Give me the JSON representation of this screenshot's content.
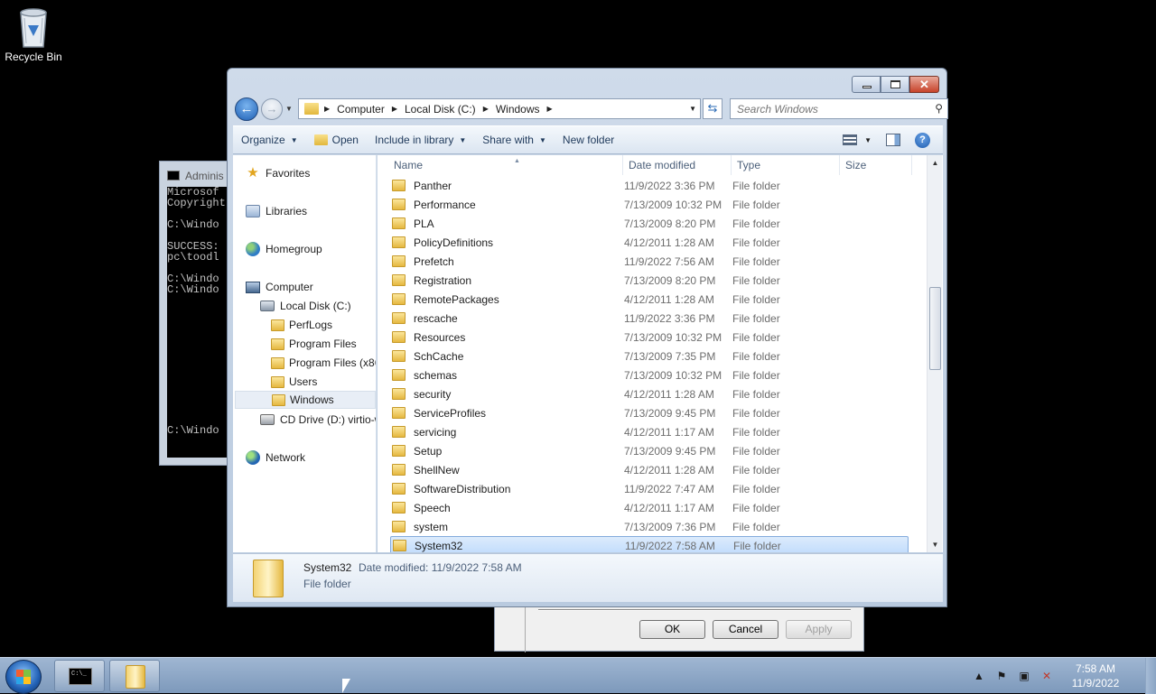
{
  "desktop": {
    "recycle_bin_label": "Recycle Bin"
  },
  "console": {
    "title": "Adminis",
    "lines": [
      "Microsof",
      "Copyright",
      "",
      "C:\\Windo",
      "",
      "SUCCESS:",
      "pc\\toodl",
      "",
      "C:\\Windo",
      "C:\\Windo",
      "",
      "",
      "",
      "",
      "",
      "",
      "",
      "",
      "",
      "",
      "",
      "",
      "C:\\Windo"
    ]
  },
  "properties_dialog": {
    "ok_label": "OK",
    "cancel_label": "Cancel",
    "apply_label": "Apply"
  },
  "explorer": {
    "breadcrumb": [
      "Computer",
      "Local Disk (C:)",
      "Windows"
    ],
    "search_placeholder": "Search Windows",
    "toolbar": {
      "organize": "Organize",
      "open": "Open",
      "include_in_library": "Include in library",
      "share_with": "Share with",
      "new_folder": "New folder"
    },
    "nav": {
      "favorites": "Favorites",
      "libraries": "Libraries",
      "homegroup": "Homegroup",
      "computer": "Computer",
      "local_disk": "Local Disk (C:)",
      "perflogs": "PerfLogs",
      "program_files": "Program Files",
      "program_files_x86": "Program Files (x86",
      "users": "Users",
      "windows": "Windows",
      "cd_drive": "CD Drive (D:) virtio-w",
      "network": "Network"
    },
    "columns": {
      "name": "Name",
      "date_modified": "Date modified",
      "type": "Type",
      "size": "Size"
    },
    "files": [
      {
        "name": "Panther",
        "date": "11/9/2022 3:36 PM",
        "type": "File folder"
      },
      {
        "name": "Performance",
        "date": "7/13/2009 10:32 PM",
        "type": "File folder"
      },
      {
        "name": "PLA",
        "date": "7/13/2009 8:20 PM",
        "type": "File folder"
      },
      {
        "name": "PolicyDefinitions",
        "date": "4/12/2011 1:28 AM",
        "type": "File folder"
      },
      {
        "name": "Prefetch",
        "date": "11/9/2022 7:56 AM",
        "type": "File folder"
      },
      {
        "name": "Registration",
        "date": "7/13/2009 8:20 PM",
        "type": "File folder"
      },
      {
        "name": "RemotePackages",
        "date": "4/12/2011 1:28 AM",
        "type": "File folder"
      },
      {
        "name": "rescache",
        "date": "11/9/2022 3:36 PM",
        "type": "File folder"
      },
      {
        "name": "Resources",
        "date": "7/13/2009 10:32 PM",
        "type": "File folder"
      },
      {
        "name": "SchCache",
        "date": "7/13/2009 7:35 PM",
        "type": "File folder"
      },
      {
        "name": "schemas",
        "date": "7/13/2009 10:32 PM",
        "type": "File folder"
      },
      {
        "name": "security",
        "date": "4/12/2011 1:28 AM",
        "type": "File folder"
      },
      {
        "name": "ServiceProfiles",
        "date": "7/13/2009 9:45 PM",
        "type": "File folder"
      },
      {
        "name": "servicing",
        "date": "4/12/2011 1:17 AM",
        "type": "File folder"
      },
      {
        "name": "Setup",
        "date": "7/13/2009 9:45 PM",
        "type": "File folder"
      },
      {
        "name": "ShellNew",
        "date": "4/12/2011 1:28 AM",
        "type": "File folder"
      },
      {
        "name": "SoftwareDistribution",
        "date": "11/9/2022 7:47 AM",
        "type": "File folder"
      },
      {
        "name": "Speech",
        "date": "4/12/2011 1:17 AM",
        "type": "File folder"
      },
      {
        "name": "system",
        "date": "7/13/2009 7:36 PM",
        "type": "File folder"
      },
      {
        "name": "System32",
        "date": "11/9/2022 7:58 AM",
        "type": "File folder",
        "selected": true
      }
    ],
    "details": {
      "name": "System32",
      "modified": "Date modified: 11/9/2022 7:58 AM",
      "type": "File folder"
    }
  },
  "taskbar": {
    "time": "7:58 AM",
    "date": "11/9/2022"
  }
}
